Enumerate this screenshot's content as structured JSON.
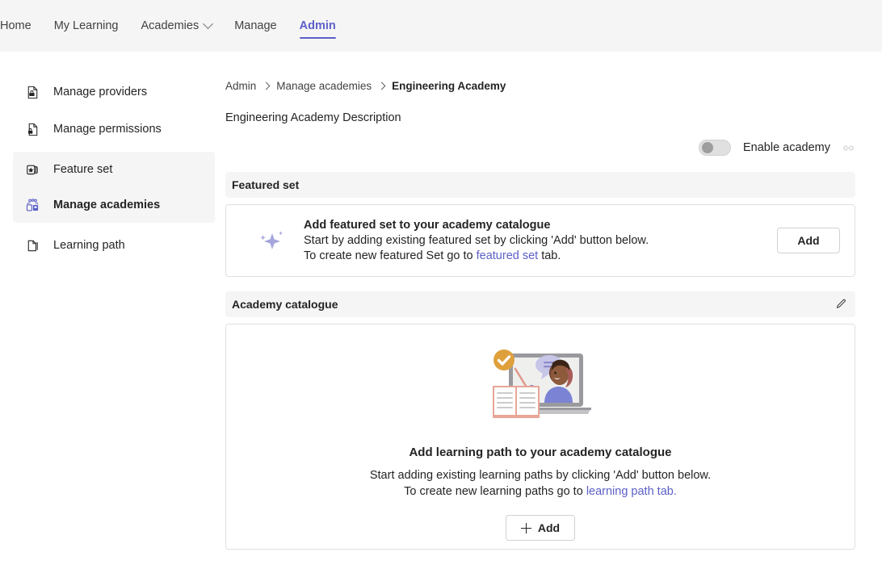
{
  "topnav": {
    "items": [
      {
        "label": "Home",
        "active": false,
        "has_chevron": false
      },
      {
        "label": "My Learning",
        "active": false,
        "has_chevron": false
      },
      {
        "label": "Academies",
        "active": false,
        "has_chevron": true
      },
      {
        "label": "Manage",
        "active": false,
        "has_chevron": false
      },
      {
        "label": "Admin",
        "active": true,
        "has_chevron": false
      }
    ]
  },
  "sidebar": {
    "items": [
      {
        "label": "Manage providers",
        "icon": "provider-document-icon",
        "selected": false
      },
      {
        "label": "Manage permissions",
        "icon": "lock-document-icon",
        "selected": false
      },
      {
        "label": "Feature set",
        "icon": "star-stack-icon",
        "selected": false
      },
      {
        "label": "Manage academies",
        "icon": "people-academy-icon",
        "selected": true
      },
      {
        "label": "Learning path",
        "icon": "page-copy-icon",
        "selected": false
      }
    ]
  },
  "breadcrumb": {
    "items": [
      "Admin",
      "Manage academies",
      "Engineering Academy"
    ]
  },
  "page": {
    "description": "Engineering Academy Description"
  },
  "enable_toggle": {
    "label": "Enable academy",
    "state": "off",
    "link_icon": "link-icon"
  },
  "featured_section": {
    "header": "Featured set",
    "icon": "sparkle-icon",
    "title": "Add featured set to your academy catalogue",
    "line1": "Start by adding existing featured set by clicking 'Add' button below.",
    "line2_prefix": "To create new featured Set go to ",
    "line2_link": "featured set",
    "line2_suffix": " tab.",
    "add_button": "Add"
  },
  "catalogue_section": {
    "header": "Academy catalogue",
    "edit_icon": "pencil-edit-icon",
    "illustration": "learning-laptop-illustration",
    "title": "Add learning path to your academy catalogue",
    "line1": "Start adding existing learning paths by clicking 'Add' button below.",
    "line2_prefix": "To create new learning paths go to ",
    "line2_link": "learning path tab.",
    "add_button": "Add",
    "add_icon": "plus-icon"
  },
  "colors": {
    "accent": "#5b5fc7",
    "header_bg": "#f5f5f5",
    "border": "#e0e0e0",
    "text": "#242424",
    "illustration_check": "#dfa03b",
    "illustration_person": "#7b83d4",
    "illustration_book": "#e8a598"
  }
}
